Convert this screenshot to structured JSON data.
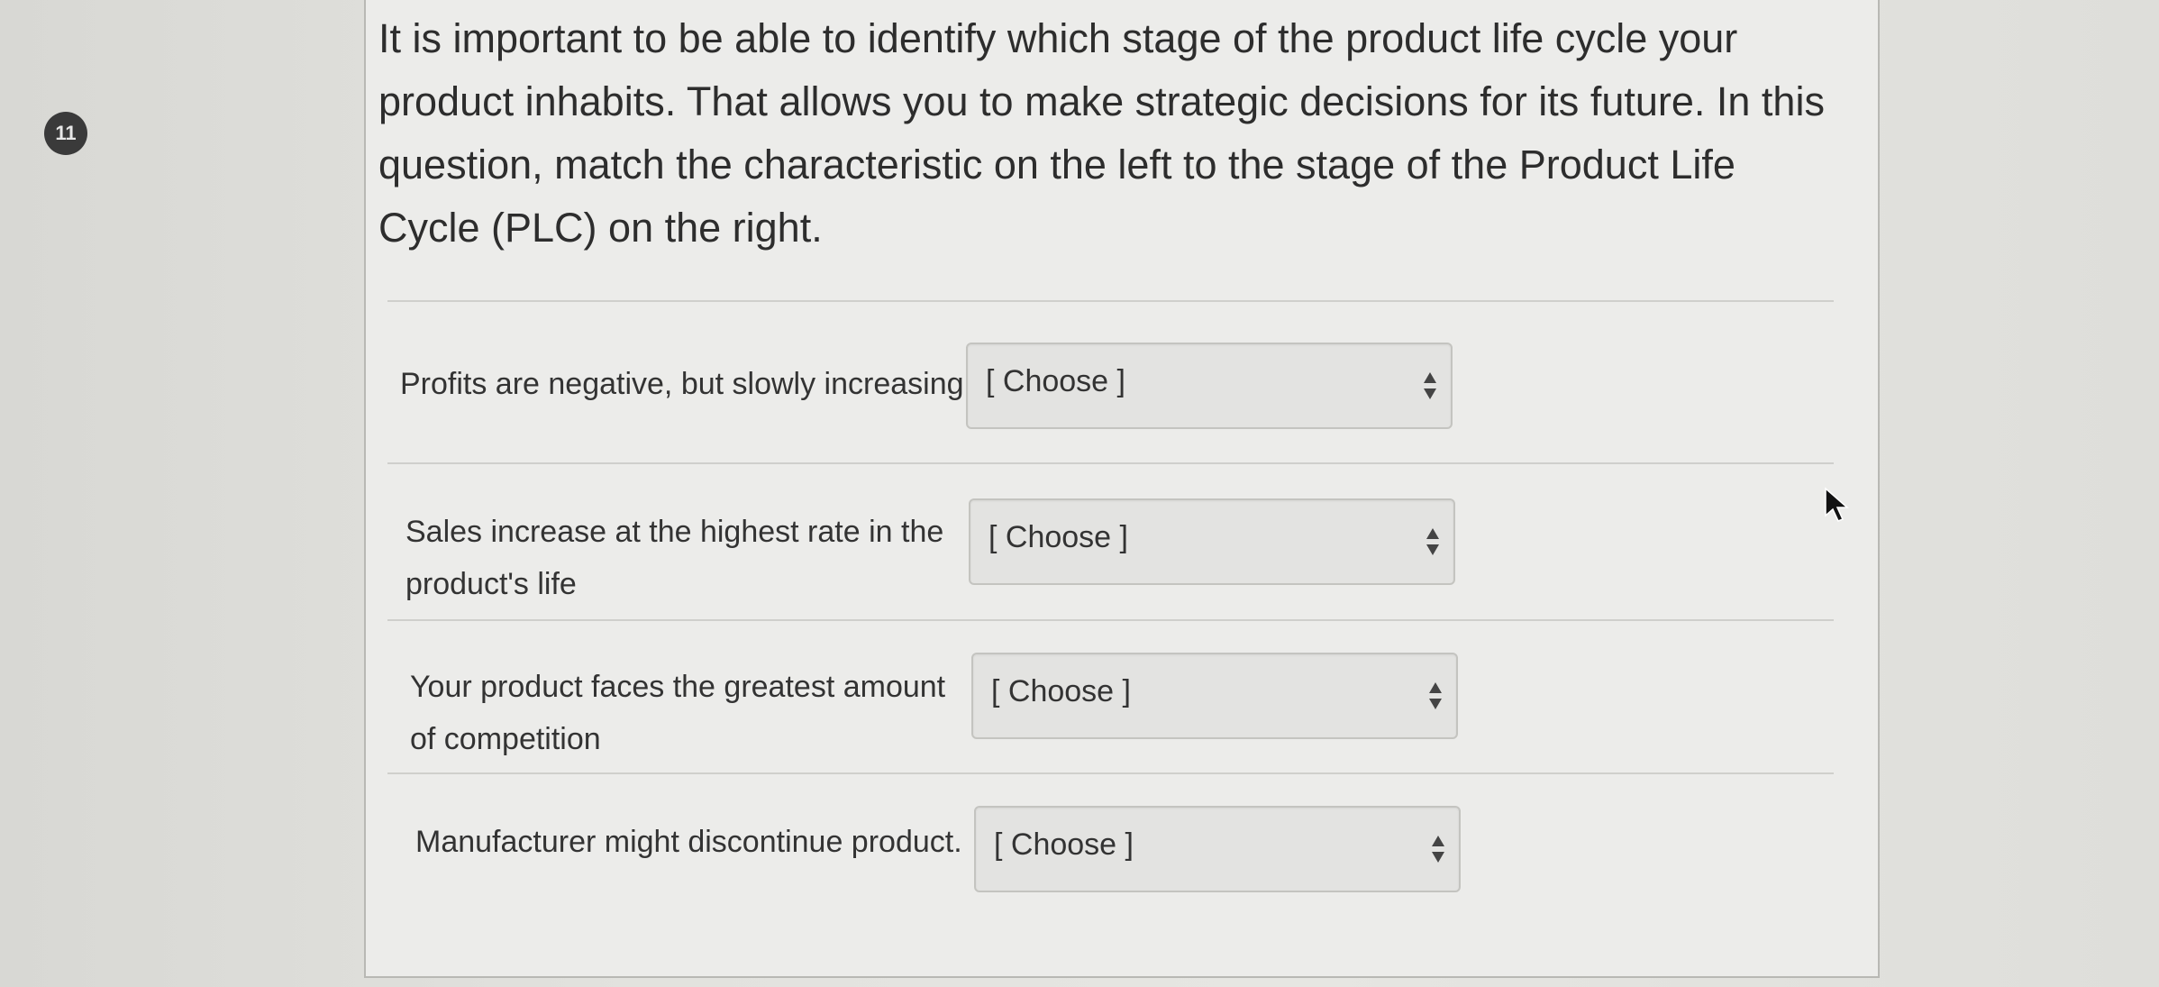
{
  "question": {
    "number": "11",
    "text": "It is important to be able to identify which stage of the product life cycle your product inhabits. That allows you to make strategic decisions for its future. In this question, match the characteristic on the left to the stage of the Product Life Cycle (PLC) on the right."
  },
  "matches": [
    {
      "label": "Profits are negative, but slowly increasing",
      "selected": "[ Choose ]"
    },
    {
      "label": "Sales increase at the highest rate in the product's life",
      "selected": "[ Choose ]"
    },
    {
      "label": "Your product faces the greatest amount of competition",
      "selected": "[ Choose ]"
    },
    {
      "label": "Manufacturer might discontinue product.",
      "selected": "[ Choose ]"
    }
  ],
  "icons": {
    "select_arrows": "up-down-arrows-icon",
    "cursor": "mouse-pointer-icon"
  }
}
